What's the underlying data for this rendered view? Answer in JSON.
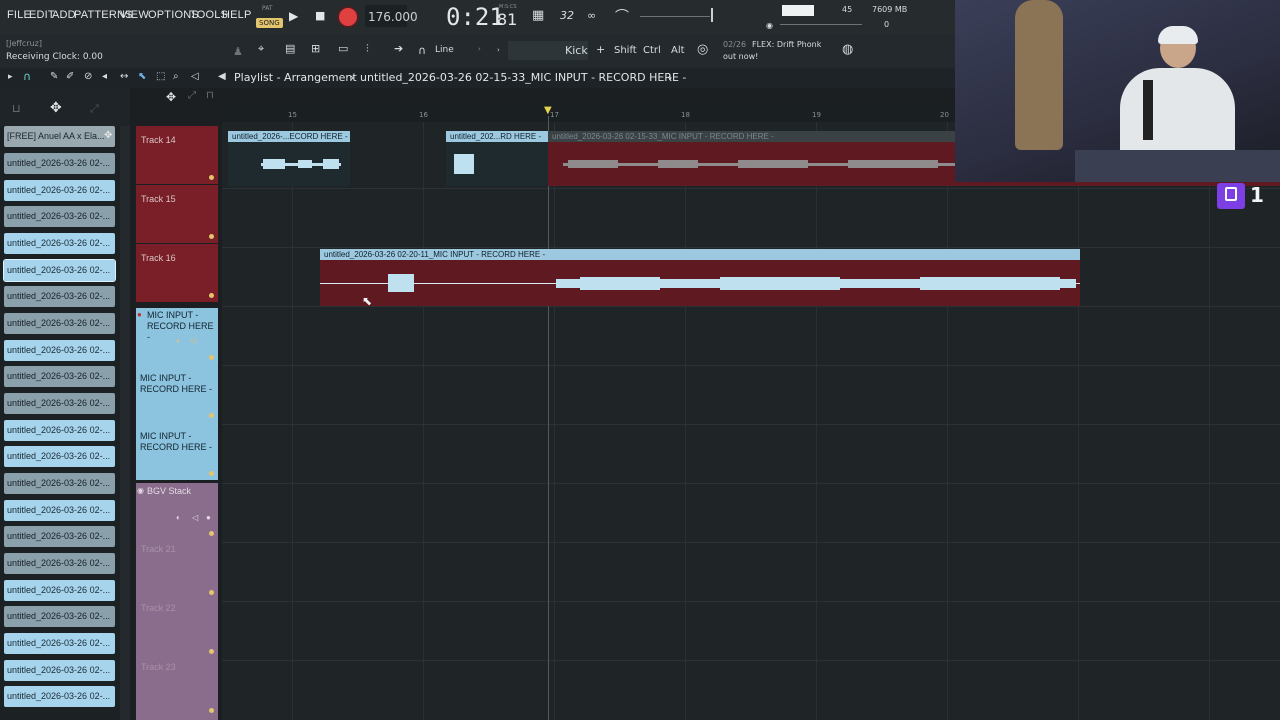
{
  "menu": [
    "FILE",
    "EDIT",
    "ADD",
    "PATTERNS",
    "VIEW",
    "OPTIONS",
    "TOOLS",
    "HELP"
  ],
  "transport": {
    "pat_label": "PAT",
    "song_label": "SONG",
    "tempo": "176.000",
    "time": "0:21",
    "time_sub": "81",
    "time_unit": "M:S:CS",
    "time_sig": "32",
    "cpu": "45",
    "memory": "7609 MB",
    "polyphony": "0"
  },
  "status": {
    "user": "[Jeffcruz]",
    "clock": "Receiving Clock: 0.00"
  },
  "tools": {
    "snap": "Line",
    "pattern": "Kick",
    "shift": "Shift",
    "ctrl": "Ctrl",
    "alt": "Alt"
  },
  "news": {
    "date": "02/26",
    "text": "FLEX: Drift Phonk",
    "text2": "out now!"
  },
  "playlist": {
    "breadcrumb": "Playlist - Arrangement",
    "path": "untitled_2026-03-26 02-15-33_MIC INPUT - RECORD HERE -",
    "arrow": "›"
  },
  "picker": {
    "items": [
      "[FREE] Anuel AA x Ela...",
      "untitled_2026-03-26 02-...",
      "untitled_2026-03-26 02-...",
      "untitled_2026-03-26 02-...",
      "untitled_2026-03-26 02-...",
      "untitled_2026-03-26 02-...",
      "untitled_2026-03-26 02-...",
      "untitled_2026-03-26 02-...",
      "untitled_2026-03-26 02-...",
      "untitled_2026-03-26 02-...",
      "untitled_2026-03-26 02-...",
      "untitled_2026-03-26 02-...",
      "untitled_2026-03-26 02-...",
      "untitled_2026-03-26 02-...",
      "untitled_2026-03-26 02-...",
      "untitled_2026-03-26 02-...",
      "untitled_2026-03-26 02-...",
      "untitled_2026-03-26 02-...",
      "untitled_2026-03-26 02-...",
      "untitled_2026-03-26 02-...",
      "untitled_2026-03-26 02-...",
      "untitled_2026-03-26 02-..."
    ]
  },
  "tracks": {
    "t14": "Track 14",
    "t15": "Track 15",
    "t16": "Track 16",
    "mic1": "MIC INPUT -\nRECORD HERE -",
    "mic2": "MIC INPUT -\nRECORD HERE -",
    "mic3": "MIC INPUT -\nRECORD HERE -",
    "bgv": "BGV Stack",
    "t21": "Track 21",
    "t22": "Track 22",
    "t23": "Track 23"
  },
  "ruler": [
    "15",
    "16",
    "17",
    "18",
    "19",
    "20"
  ],
  "clips": {
    "c1": "untitled_2026-...ECORD HERE -",
    "c2": "untitled_202...RD HERE -",
    "c3": "untitled_2026-03-26 02-15-33_MIC INPUT - RECORD HERE -",
    "c4": "untitled_2026-03-26 02-20-11_MIC INPUT - RECORD HERE -"
  },
  "twitch": {
    "count": "1"
  },
  "colors": {
    "accent_red": "#7a1f27",
    "clip_blue": "#8cc3df",
    "purple": "#8a6d8c",
    "record_red": "#e04040"
  }
}
